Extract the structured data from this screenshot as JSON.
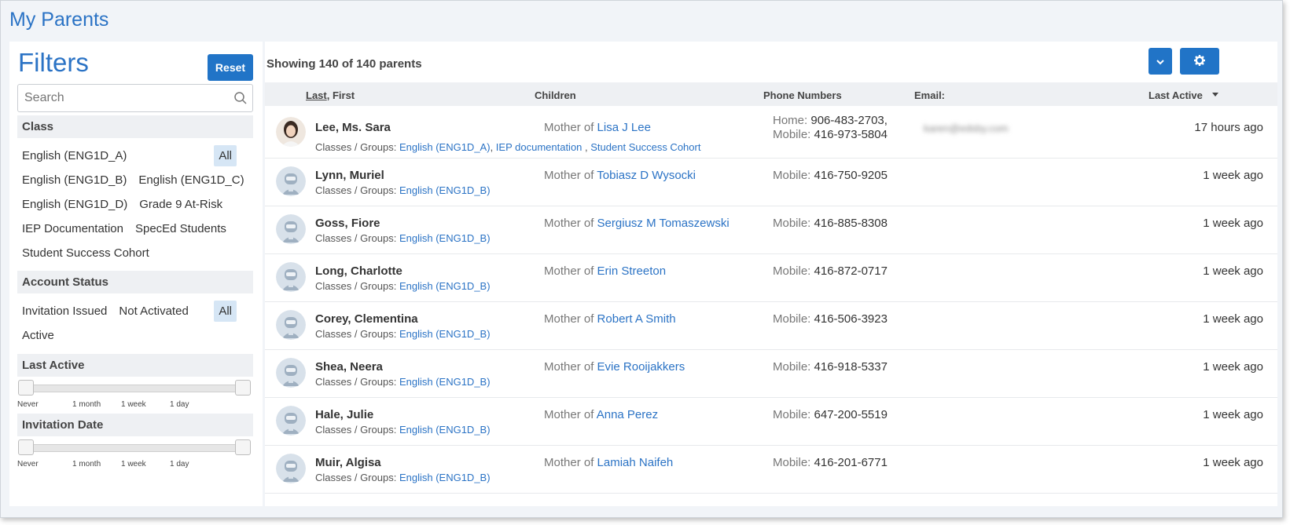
{
  "page_title": "My Parents",
  "filters": {
    "title": "Filters",
    "reset_label": "Reset",
    "search_placeholder": "Search",
    "class_heading": "Class",
    "class_options": [
      "All",
      "English (ENG1D_A)",
      "English (ENG1D_B)",
      "English (ENG1D_C)",
      "English (ENG1D_D)",
      "Grade 9 At-Risk",
      "IEP Documentation",
      "SpecEd Students",
      "Student Success Cohort"
    ],
    "status_heading": "Account Status",
    "status_options": [
      "All",
      "Invitation Issued",
      "Not Activated",
      "Active"
    ],
    "last_active_heading": "Last Active",
    "invitation_heading": "Invitation Date",
    "slider_ticks": [
      "Never",
      "1 month",
      "1 week",
      "1 day"
    ]
  },
  "main": {
    "showing_text": "Showing 140 of 140 parents",
    "columns": {
      "last": "Last",
      "first": ", First",
      "children": "Children",
      "phones": "Phone Numbers",
      "email": "Email:",
      "last_active": "Last Active"
    },
    "groups_label": "Classes / Groups:",
    "child_prefix": "Mother of",
    "rows": [
      {
        "name": "Lee, Ms. Sara",
        "photo": true,
        "groups": [
          "English (ENG1D_A)",
          "IEP documentation",
          "Student Success Cohort"
        ],
        "child": "Lisa J Lee",
        "phones": [
          {
            "type": "Home:",
            "number": "906-483-2703,"
          },
          {
            "type": "Mobile:",
            "number": "416-973-5804"
          }
        ],
        "email": "karen@edsby.com",
        "last_active": "17 hours ago"
      },
      {
        "name": "Lynn, Muriel",
        "photo": false,
        "groups": [
          "English (ENG1D_B)"
        ],
        "child": "Tobiasz D Wysocki",
        "phones": [
          {
            "type": "Mobile:",
            "number": "416-750-9205"
          }
        ],
        "email": "",
        "last_active": "1 week ago"
      },
      {
        "name": "Goss, Fiore",
        "photo": false,
        "groups": [
          "English (ENG1D_B)"
        ],
        "child": "Sergiusz M Tomaszewski",
        "phones": [
          {
            "type": "Mobile:",
            "number": "416-885-8308"
          }
        ],
        "email": "",
        "last_active": "1 week ago"
      },
      {
        "name": "Long, Charlotte",
        "photo": false,
        "groups": [
          "English (ENG1D_B)"
        ],
        "child": "Erin Streeton",
        "phones": [
          {
            "type": "Mobile:",
            "number": "416-872-0717"
          }
        ],
        "email": "",
        "last_active": "1 week ago"
      },
      {
        "name": "Corey, Clementina",
        "photo": false,
        "groups": [
          "English (ENG1D_B)"
        ],
        "child": "Robert A Smith",
        "phones": [
          {
            "type": "Mobile:",
            "number": "416-506-3923"
          }
        ],
        "email": "",
        "last_active": "1 week ago"
      },
      {
        "name": "Shea, Neera",
        "photo": false,
        "groups": [
          "English (ENG1D_B)"
        ],
        "child": "Evie Rooijakkers",
        "phones": [
          {
            "type": "Mobile:",
            "number": "416-918-5337"
          }
        ],
        "email": "",
        "last_active": "1 week ago"
      },
      {
        "name": "Hale, Julie",
        "photo": false,
        "groups": [
          "English (ENG1D_B)"
        ],
        "child": "Anna Perez",
        "phones": [
          {
            "type": "Mobile:",
            "number": "647-200-5519"
          }
        ],
        "email": "",
        "last_active": "1 week ago"
      },
      {
        "name": "Muir, Algisa",
        "photo": false,
        "groups": [
          "English (ENG1D_B)"
        ],
        "child": "Lamiah Naifeh",
        "phones": [
          {
            "type": "Mobile:",
            "number": "416-201-6771"
          }
        ],
        "email": "",
        "last_active": "1 week ago"
      }
    ]
  },
  "colors": {
    "accent": "#2174c7",
    "link": "#2b73c5",
    "chip_active": "#d6e6f5"
  }
}
